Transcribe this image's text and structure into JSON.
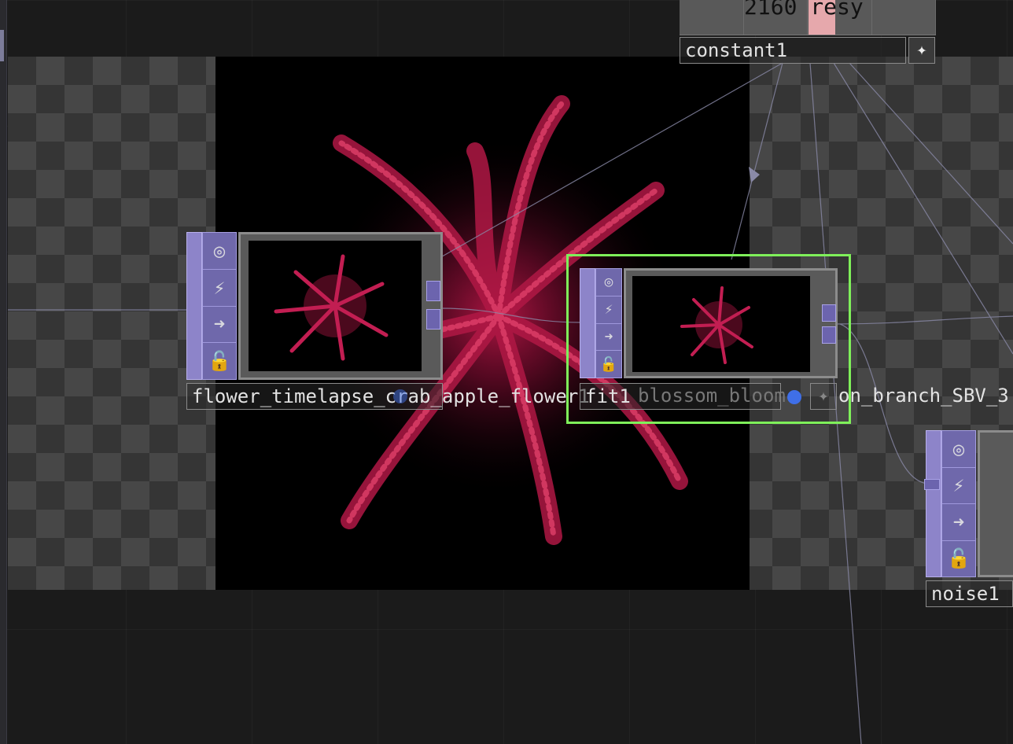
{
  "nodes": {
    "constant1": {
      "label": "constant1",
      "display_text": "2160 resy",
      "button_icon": "star-icon"
    },
    "flower": {
      "label": "flower_timelapse_crab_apple_flower1"
    },
    "fit1": {
      "label": "fit1"
    },
    "blossom": {
      "label": "blossom_bloom",
      "label_tail": "on_branch_SBV_3"
    },
    "noise1": {
      "label": "noise1"
    }
  },
  "icons": [
    "target-icon",
    "flag-icon",
    "arrow-right-icon",
    "unlock-icon",
    "star-icon"
  ],
  "colors": {
    "selection": "#7ff05a",
    "node_accent": "#8d84c9",
    "viewer_dot": "#3f6fe8",
    "constant_highlight": "#e6a8ac"
  }
}
